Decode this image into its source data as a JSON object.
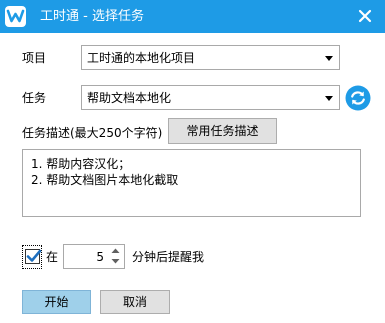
{
  "window": {
    "title": "工时通 - 选择任务"
  },
  "form": {
    "project_label": "项目",
    "project_value": "工时通的本地化项目",
    "task_label": "任务",
    "task_value": "帮助文档本地化",
    "description_label": "任务描述(最大250个字符)",
    "common_desc_button": "常用任务描述",
    "description_lines": [
      "1. 帮助内容汉化；",
      "2. 帮助文档图片本地化截取"
    ],
    "reminder": {
      "checked": true,
      "prefix": "在",
      "minutes": "5",
      "suffix": "分钟后提醒我"
    }
  },
  "footer": {
    "start_button": "开始",
    "cancel_button": "取消"
  },
  "colors": {
    "titlebar": "#1e9be6",
    "primary_button": "#9fd0ea",
    "refresh_icon": "#1e9be6"
  },
  "icons": {
    "app": "app-logo-icon",
    "close": "close-icon",
    "refresh": "refresh-icon",
    "check": "check-icon"
  }
}
